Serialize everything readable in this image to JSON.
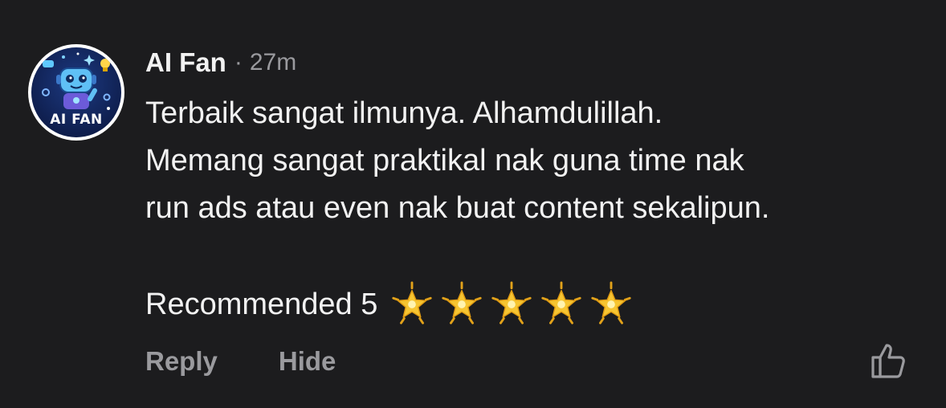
{
  "comment": {
    "author": "AI Fan",
    "separator": "·",
    "timestamp": "27m",
    "avatar": {
      "label": "AI FAN",
      "icon": "robot-avatar-icon"
    },
    "body_lines": [
      "Terbaik sangat ilmunya. Alhamdulillah.",
      "Memang sangat praktikal nak guna time nak",
      "run ads atau even nak buat content sekalipun."
    ],
    "recommend_text": "Recommended 5",
    "rating": {
      "value": 5,
      "max": 5,
      "icon": "glowing-star-icon"
    },
    "actions": {
      "reply_label": "Reply",
      "hide_label": "Hide",
      "like_icon": "thumbs-up-icon"
    }
  },
  "colors": {
    "background": "#1c1c1e",
    "primary_text": "#f2f2f2",
    "secondary_text": "#9a9a9e",
    "star": "#f7c531"
  }
}
